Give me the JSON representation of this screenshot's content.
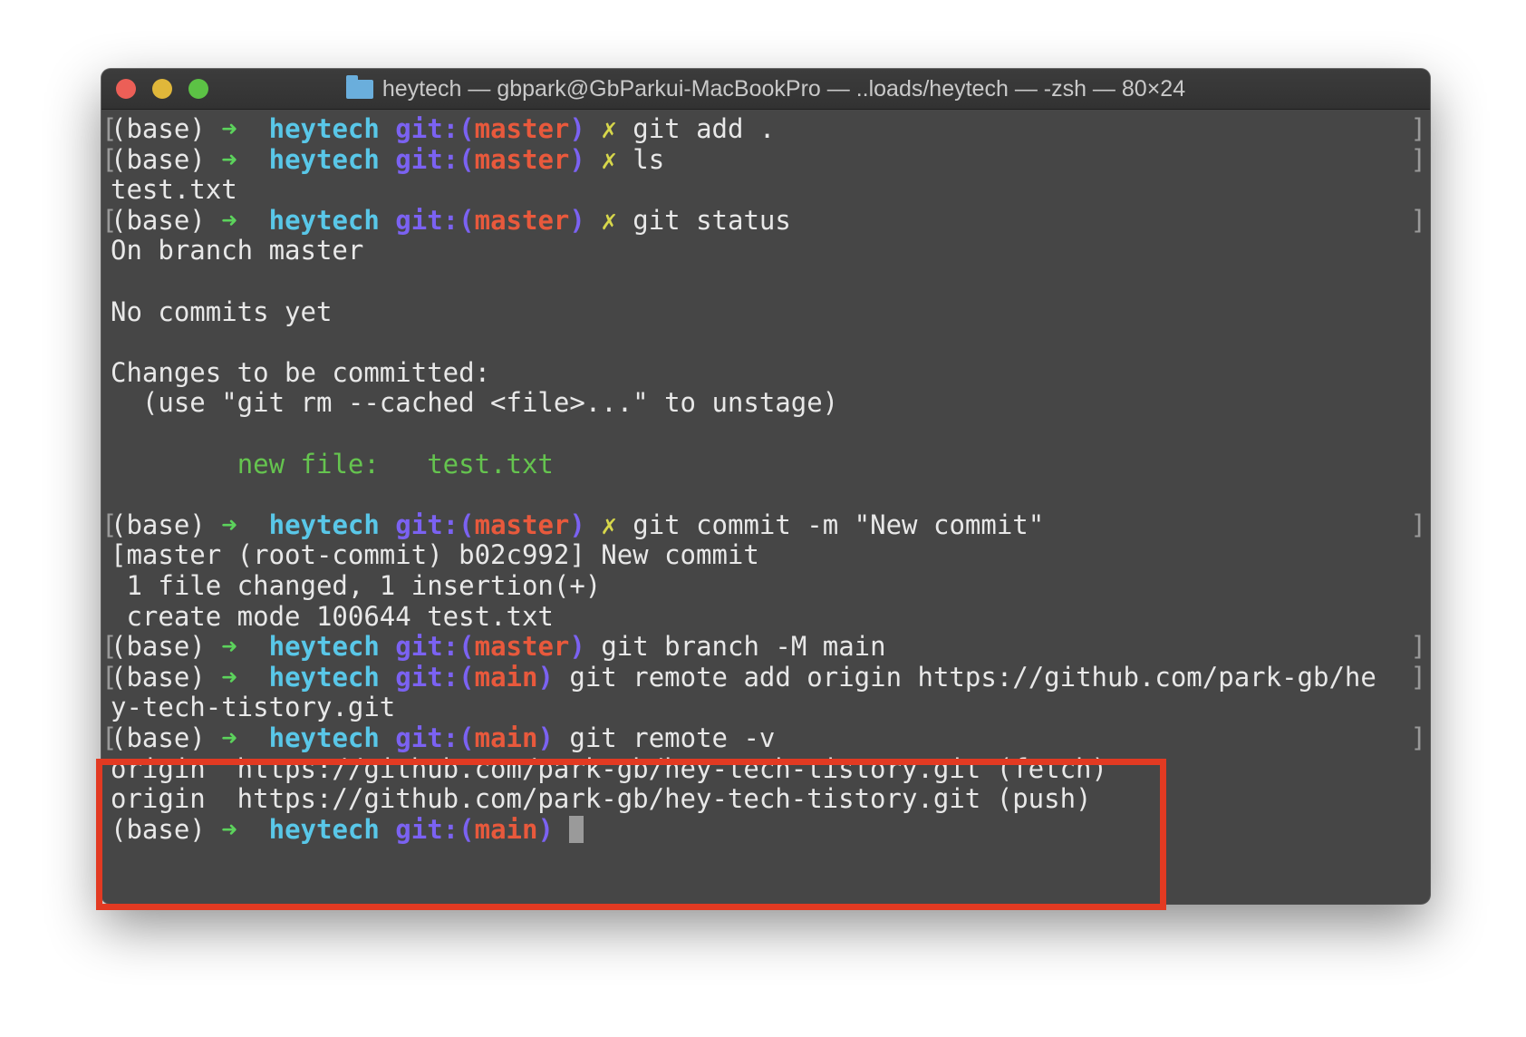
{
  "window": {
    "title": "heytech — gbpark@GbParkui-MacBookPro — ..loads/heytech — -zsh — 80×24",
    "folder_icon": "folder-icon"
  },
  "prompt": {
    "env": "(base) ",
    "arrow": "➜",
    "dir": "heytech",
    "git_open": "git:(",
    "git_close": ")",
    "dirty": "✗"
  },
  "lines": [
    {
      "type": "cmd",
      "branch": "master",
      "dirty": true,
      "cmd": "git add ."
    },
    {
      "type": "cmd",
      "branch": "master",
      "dirty": true,
      "cmd": "ls"
    },
    {
      "type": "out",
      "text": "test.txt"
    },
    {
      "type": "cmd",
      "branch": "master",
      "dirty": true,
      "cmd": "git status"
    },
    {
      "type": "out",
      "text": "On branch master"
    },
    {
      "type": "out",
      "text": ""
    },
    {
      "type": "out",
      "text": "No commits yet"
    },
    {
      "type": "out",
      "text": ""
    },
    {
      "type": "out",
      "text": "Changes to be committed:"
    },
    {
      "type": "out",
      "text": "  (use \"git rm --cached <file>...\" to unstage)"
    },
    {
      "type": "out",
      "text": ""
    },
    {
      "type": "new",
      "label": "new file:",
      "file": "test.txt"
    },
    {
      "type": "out",
      "text": ""
    },
    {
      "type": "cmd",
      "branch": "master",
      "dirty": true,
      "cmd": "git commit -m \"New commit\""
    },
    {
      "type": "out",
      "text": "[master (root-commit) b02c992] New commit"
    },
    {
      "type": "out",
      "text": " 1 file changed, 1 insertion(+)"
    },
    {
      "type": "out",
      "text": " create mode 100644 test.txt"
    },
    {
      "type": "cmd",
      "branch": "master",
      "dirty": false,
      "cmd": "git branch -M main"
    },
    {
      "type": "cmd",
      "branch": "main",
      "dirty": false,
      "cmd": "git remote add origin https://github.com/park-gb/he"
    },
    {
      "type": "out",
      "text": "y-tech-tistory.git"
    },
    {
      "type": "cmd",
      "branch": "main",
      "dirty": false,
      "cmd": "git remote -v"
    },
    {
      "type": "out",
      "text": "origin  https://github.com/park-gb/hey-tech-tistory.git (fetch)"
    },
    {
      "type": "out",
      "text": "origin  https://github.com/park-gb/hey-tech-tistory.git (push)"
    },
    {
      "type": "cursor",
      "branch": "main"
    }
  ],
  "colors": {
    "terminal_bg": "#464646",
    "highlight": "#e23a22",
    "arrow": "#5cd35c",
    "dir": "#59c7e8",
    "git": "#7b62f2",
    "branch": "#e8593c",
    "dirty": "#d7d74b",
    "new_file": "#65c44f"
  }
}
